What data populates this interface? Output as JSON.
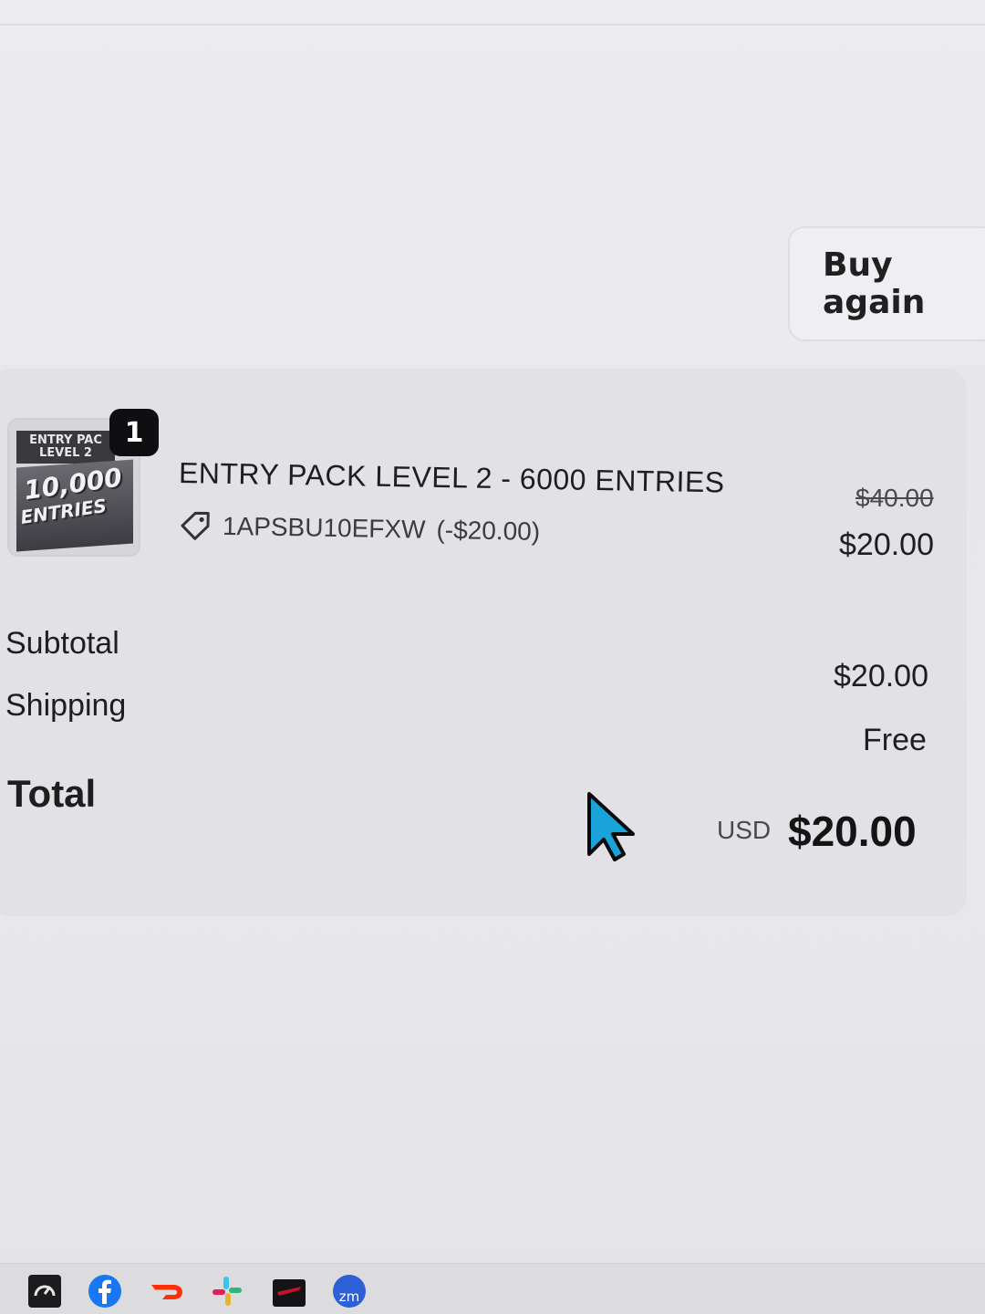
{
  "header": {
    "buy_again_label": "Buy again"
  },
  "order": {
    "item": {
      "quantity": "1",
      "thumbnail": {
        "top_text": "ENTRY PAC\nLEVEL 2",
        "big_text": "10,000",
        "sub_text": "ENTRIES"
      },
      "title": "ENTRY PACK LEVEL 2 - 6000 ENTRIES",
      "discount_icon": "tag-icon",
      "discount_code": "1APSBU10EFXW",
      "discount_amount": "(-$20.00)",
      "original_price": "$40.00",
      "price": "$20.00"
    },
    "summary": {
      "subtotal_label": "Subtotal",
      "subtotal_value": "$20.00",
      "shipping_label": "Shipping",
      "shipping_value": "Free",
      "total_label": "Total",
      "currency": "USD",
      "total_value": "$20.00"
    }
  },
  "taskbar": {
    "icons": [
      "speedometer-icon",
      "facebook-icon",
      "doordash-icon",
      "slack-icon",
      "game-icon",
      "zoom-icon"
    ],
    "zoom_label": "zm"
  },
  "colors": {
    "background": "#e9e8ec",
    "card": "#e2e1e6",
    "badge": "#0f0f12",
    "cursor": "#1aa3d9",
    "facebook": "#1877f2",
    "doordash": "#ff3008",
    "zoom": "#2d5fd6"
  }
}
